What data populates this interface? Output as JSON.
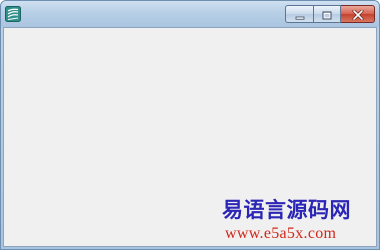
{
  "window": {
    "controls": {
      "minimize": "minimize",
      "maximize": "maximize",
      "close": "close"
    },
    "icon": "app-icon"
  },
  "watermark": {
    "title": "易语言源码网",
    "url": "www.e5a5x.com"
  },
  "colors": {
    "titlebar": "#b8cfe6",
    "client": "#f0f0f0",
    "close_button": "#c4412e",
    "watermark_title": "#2b26b5",
    "watermark_url": "#d1281a"
  }
}
